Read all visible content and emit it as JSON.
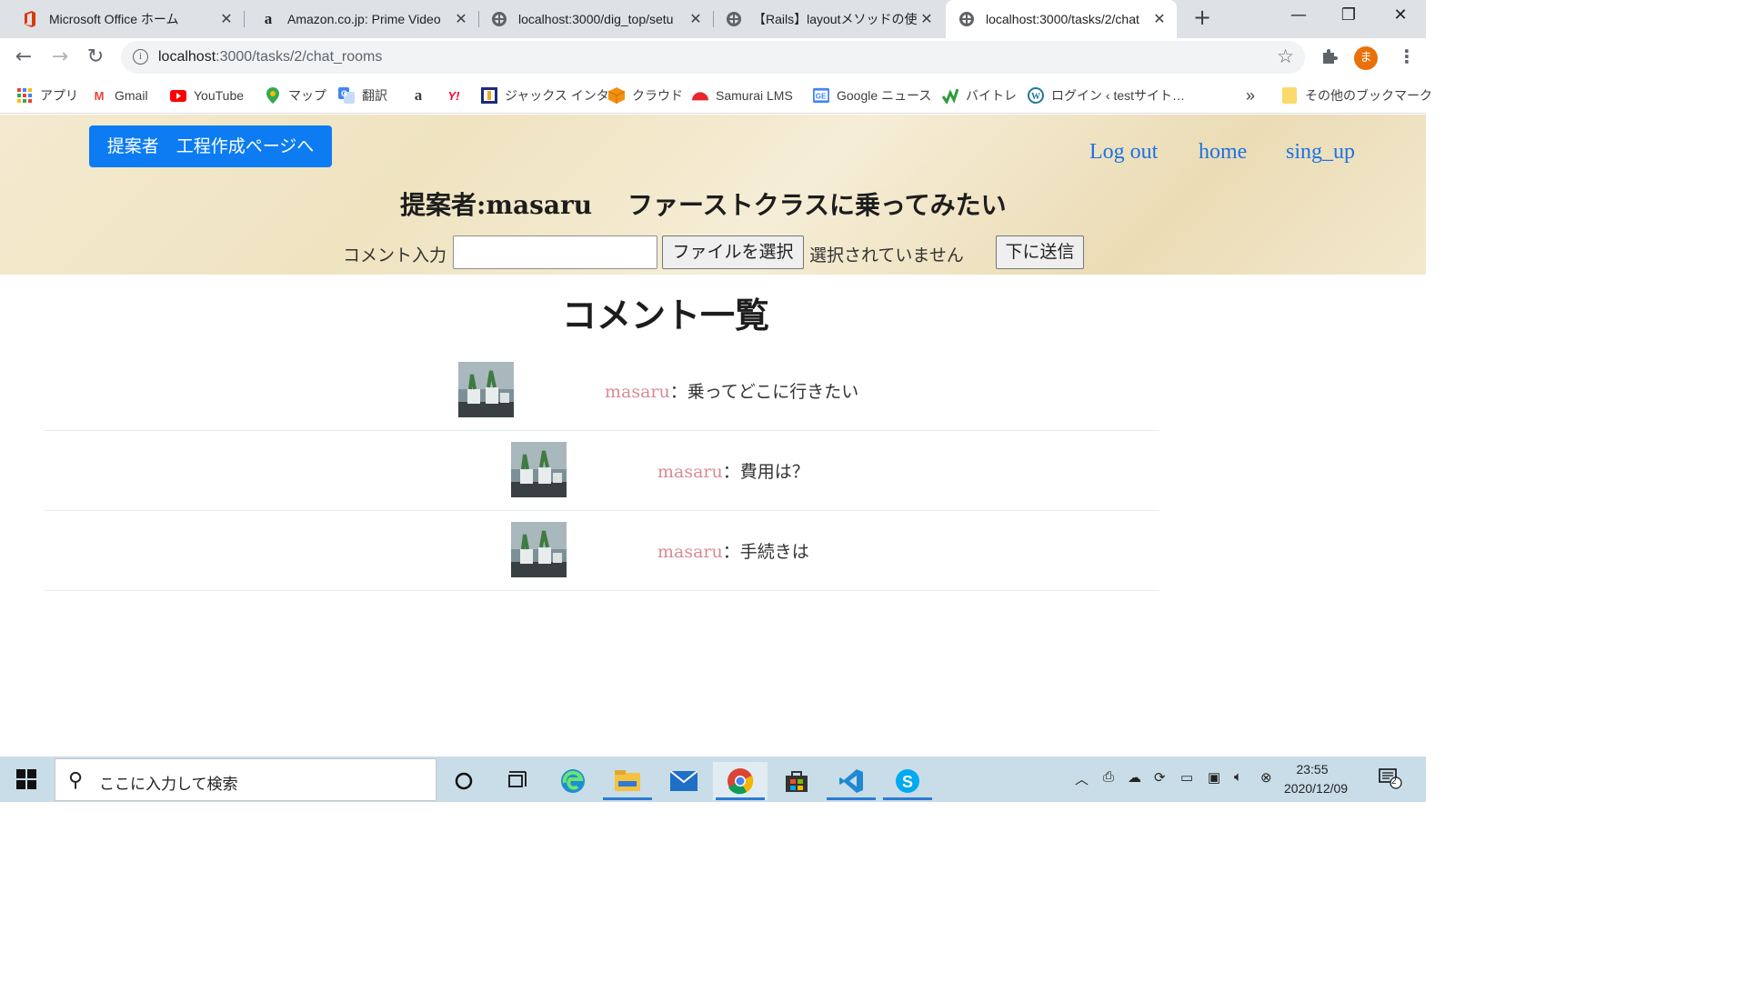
{
  "browser": {
    "tabs": [
      {
        "title": "Microsoft Office ホーム",
        "favicon": "office-icon",
        "active": false
      },
      {
        "title": "Amazon.co.jp: Prime Video",
        "favicon": "amazon-icon",
        "active": false
      },
      {
        "title": "localhost:3000/dig_top/setu",
        "favicon": "globe-icon",
        "active": false
      },
      {
        "title": "【Rails】layoutメソッドの使い方",
        "favicon": "globe-icon",
        "active": false
      },
      {
        "title": "localhost:3000/tasks/2/chat",
        "favicon": "globe-icon",
        "active": true
      }
    ],
    "new_tab": "+",
    "url_host": "localhost",
    "url_rest": ":3000/tasks/2/chat_rooms",
    "profile_initial": "ま",
    "bookmarks": [
      {
        "label": "アプリ",
        "icon": "apps-grid-icon"
      },
      {
        "label": "Gmail",
        "icon": "gmail-icon"
      },
      {
        "label": "YouTube",
        "icon": "youtube-icon"
      },
      {
        "label": "マップ",
        "icon": "maps-pin-icon"
      },
      {
        "label": "翻訳",
        "icon": "translate-icon"
      },
      {
        "label": "",
        "icon": "amazon-icon"
      },
      {
        "label": "",
        "icon": "yahoo-icon"
      },
      {
        "label": "ジャックス インタ",
        "icon": "jaccs-icon"
      },
      {
        "label": "クラウド",
        "icon": "cloud-box-icon"
      },
      {
        "label": "Samurai LMS",
        "icon": "samurai-icon"
      },
      {
        "label": "Google ニュース",
        "icon": "google-news-icon"
      },
      {
        "label": "バイトレ",
        "icon": "baitore-icon"
      },
      {
        "label": "ログイン ‹ testサイト…",
        "icon": "wordpress-icon"
      }
    ],
    "overflow": "»",
    "other_bookmarks": "その他のブックマーク"
  },
  "page": {
    "proposer_button": "提案者　工程作成ページへ",
    "nav": {
      "logout": "Log out",
      "home": "home",
      "signup": "sing_up"
    },
    "proposer": "提案者:masaru",
    "task_title": "ファーストクラスに乗ってみたい",
    "form": {
      "label": "コメント入力",
      "input_value": "",
      "file_button": "ファイルを選択",
      "no_file": "選択されていません",
      "submit": "下に送信"
    },
    "list_title": "コメント一覧",
    "comments": [
      {
        "user": "masaru",
        "sep": "：",
        "text": "乗ってどこに行きたい"
      },
      {
        "user": "masaru",
        "sep": "：",
        "text": "費用は？"
      },
      {
        "user": "masaru",
        "sep": "：",
        "text": "手続きは"
      }
    ]
  },
  "taskbar": {
    "search_placeholder": "ここに入力して検索",
    "time": "23:55",
    "date": "2020/12/09",
    "notification_count": "2"
  },
  "colors": {
    "accent_button": "#0d7cf2",
    "link": "#1a73e8",
    "username": "#d98a96"
  }
}
